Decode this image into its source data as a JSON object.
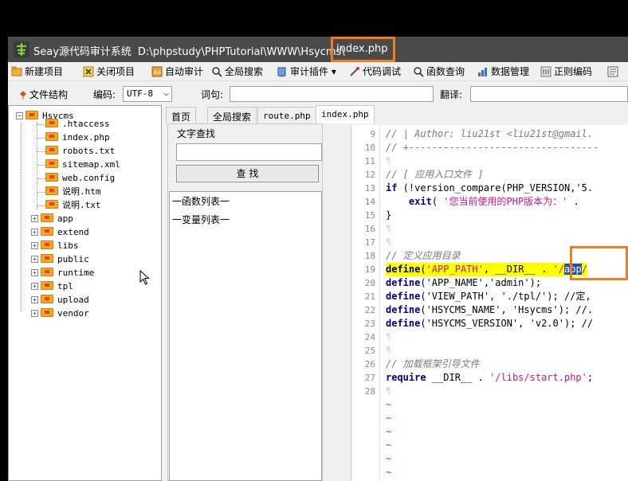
{
  "window": {
    "app_name": "Seay源代码审计系统",
    "path": "D:\\phpstudy\\PHPTutorial\\WWW\\Hsycms\\",
    "file_name": "index.php",
    "highlight_color": "#f07b22"
  },
  "toolbar": {
    "items": [
      {
        "label": "新建项目",
        "icon": "new-project-icon"
      },
      {
        "label": "关闭项目",
        "icon": "close-project-icon"
      },
      {
        "label": "自动审计",
        "icon": "auto-audit-icon"
      },
      {
        "label": "全局搜索",
        "icon": "global-search-icon"
      },
      {
        "label": "审计插件",
        "icon": "plugin-icon"
      },
      {
        "label": "代码调试",
        "icon": "debug-icon"
      },
      {
        "label": "函数查询",
        "icon": "function-query-icon"
      },
      {
        "label": "数据管理",
        "icon": "data-manage-icon"
      },
      {
        "label": "正则编码",
        "icon": "regex-icon"
      }
    ],
    "dropdown_arrow": "▾"
  },
  "searchbar": {
    "file_structure_label": "文件结构",
    "encoding_label": "编码:",
    "encoding_value": "UTF-8",
    "query_label": "词句:",
    "query_value": "",
    "translate_label": "翻译:",
    "translate_value": ""
  },
  "tree": {
    "root": "Hsycms",
    "files": [
      ".htaccess",
      "index.php",
      "robots.txt",
      "sitemap.xml",
      "web.config",
      "说明.htm",
      "说明.txt"
    ],
    "folders": [
      "app",
      "extend",
      "libs",
      "public",
      "runtime",
      "tpl",
      "upload",
      "vendor"
    ],
    "collapse_symbol": "−",
    "expand_symbol": "+"
  },
  "tabs": [
    {
      "label": "首页"
    },
    {
      "label": "全局搜索"
    },
    {
      "label": "route.php"
    },
    {
      "label": "index.php"
    }
  ],
  "text_search": {
    "title": "文字查找",
    "input_value": "",
    "button_label": "查 找",
    "function_list": "一函数列表一",
    "variable_list": "一变量列表一"
  },
  "editor": {
    "line_numbers": [
      "9",
      "10",
      "11",
      "12",
      "13",
      "14",
      "15",
      "16",
      "17",
      "18",
      "19",
      "20",
      "21",
      "22",
      "23",
      "24",
      "25",
      "26",
      "27",
      "28"
    ],
    "l9": "// | Author: liu21st <liu21st@gmail.",
    "l10": "// +---------------------------------",
    "pilcrow": "¶",
    "l12": "// [ 应用入口文件 ]",
    "l13_kw": "if",
    "l13_rest": " (!version_compare(PHP_VERSION,'5.",
    "l14_kw": "exit",
    "l14_rest": "( ",
    "l14_str": "'您当前使用的PHP版本为：'",
    "l14_end": " .",
    "l15": "}",
    "l18": "// 定义应用目录",
    "l19_kw": "define",
    "l19_a": "(",
    "l19_str": "'APP_PATH'",
    "l19_b": ", __DIR__ . ",
    "l19_q1": "'/",
    "l19_sel": "app",
    "l19_q2": "/",
    "l20_kw": "define",
    "l20_rest": "('APP_NAME','admin');",
    "l21_kw": "define",
    "l21_rest": "('VIEW_PATH', './tpl/'); //定,",
    "l22_kw": "define",
    "l22_rest": "('HSYCMS_NAME', 'Hsycms'); //.",
    "l23_kw": "define",
    "l23_rest": "('HSYCMS_VERSION', 'v2.0'); //",
    "l26": "// 加载框架引导文件",
    "l27_kw": "require",
    "l27_a": " __DIR__ . ",
    "l27_str": "'/libs/start.php'",
    "l27_b": ";",
    "tilde": "~"
  }
}
